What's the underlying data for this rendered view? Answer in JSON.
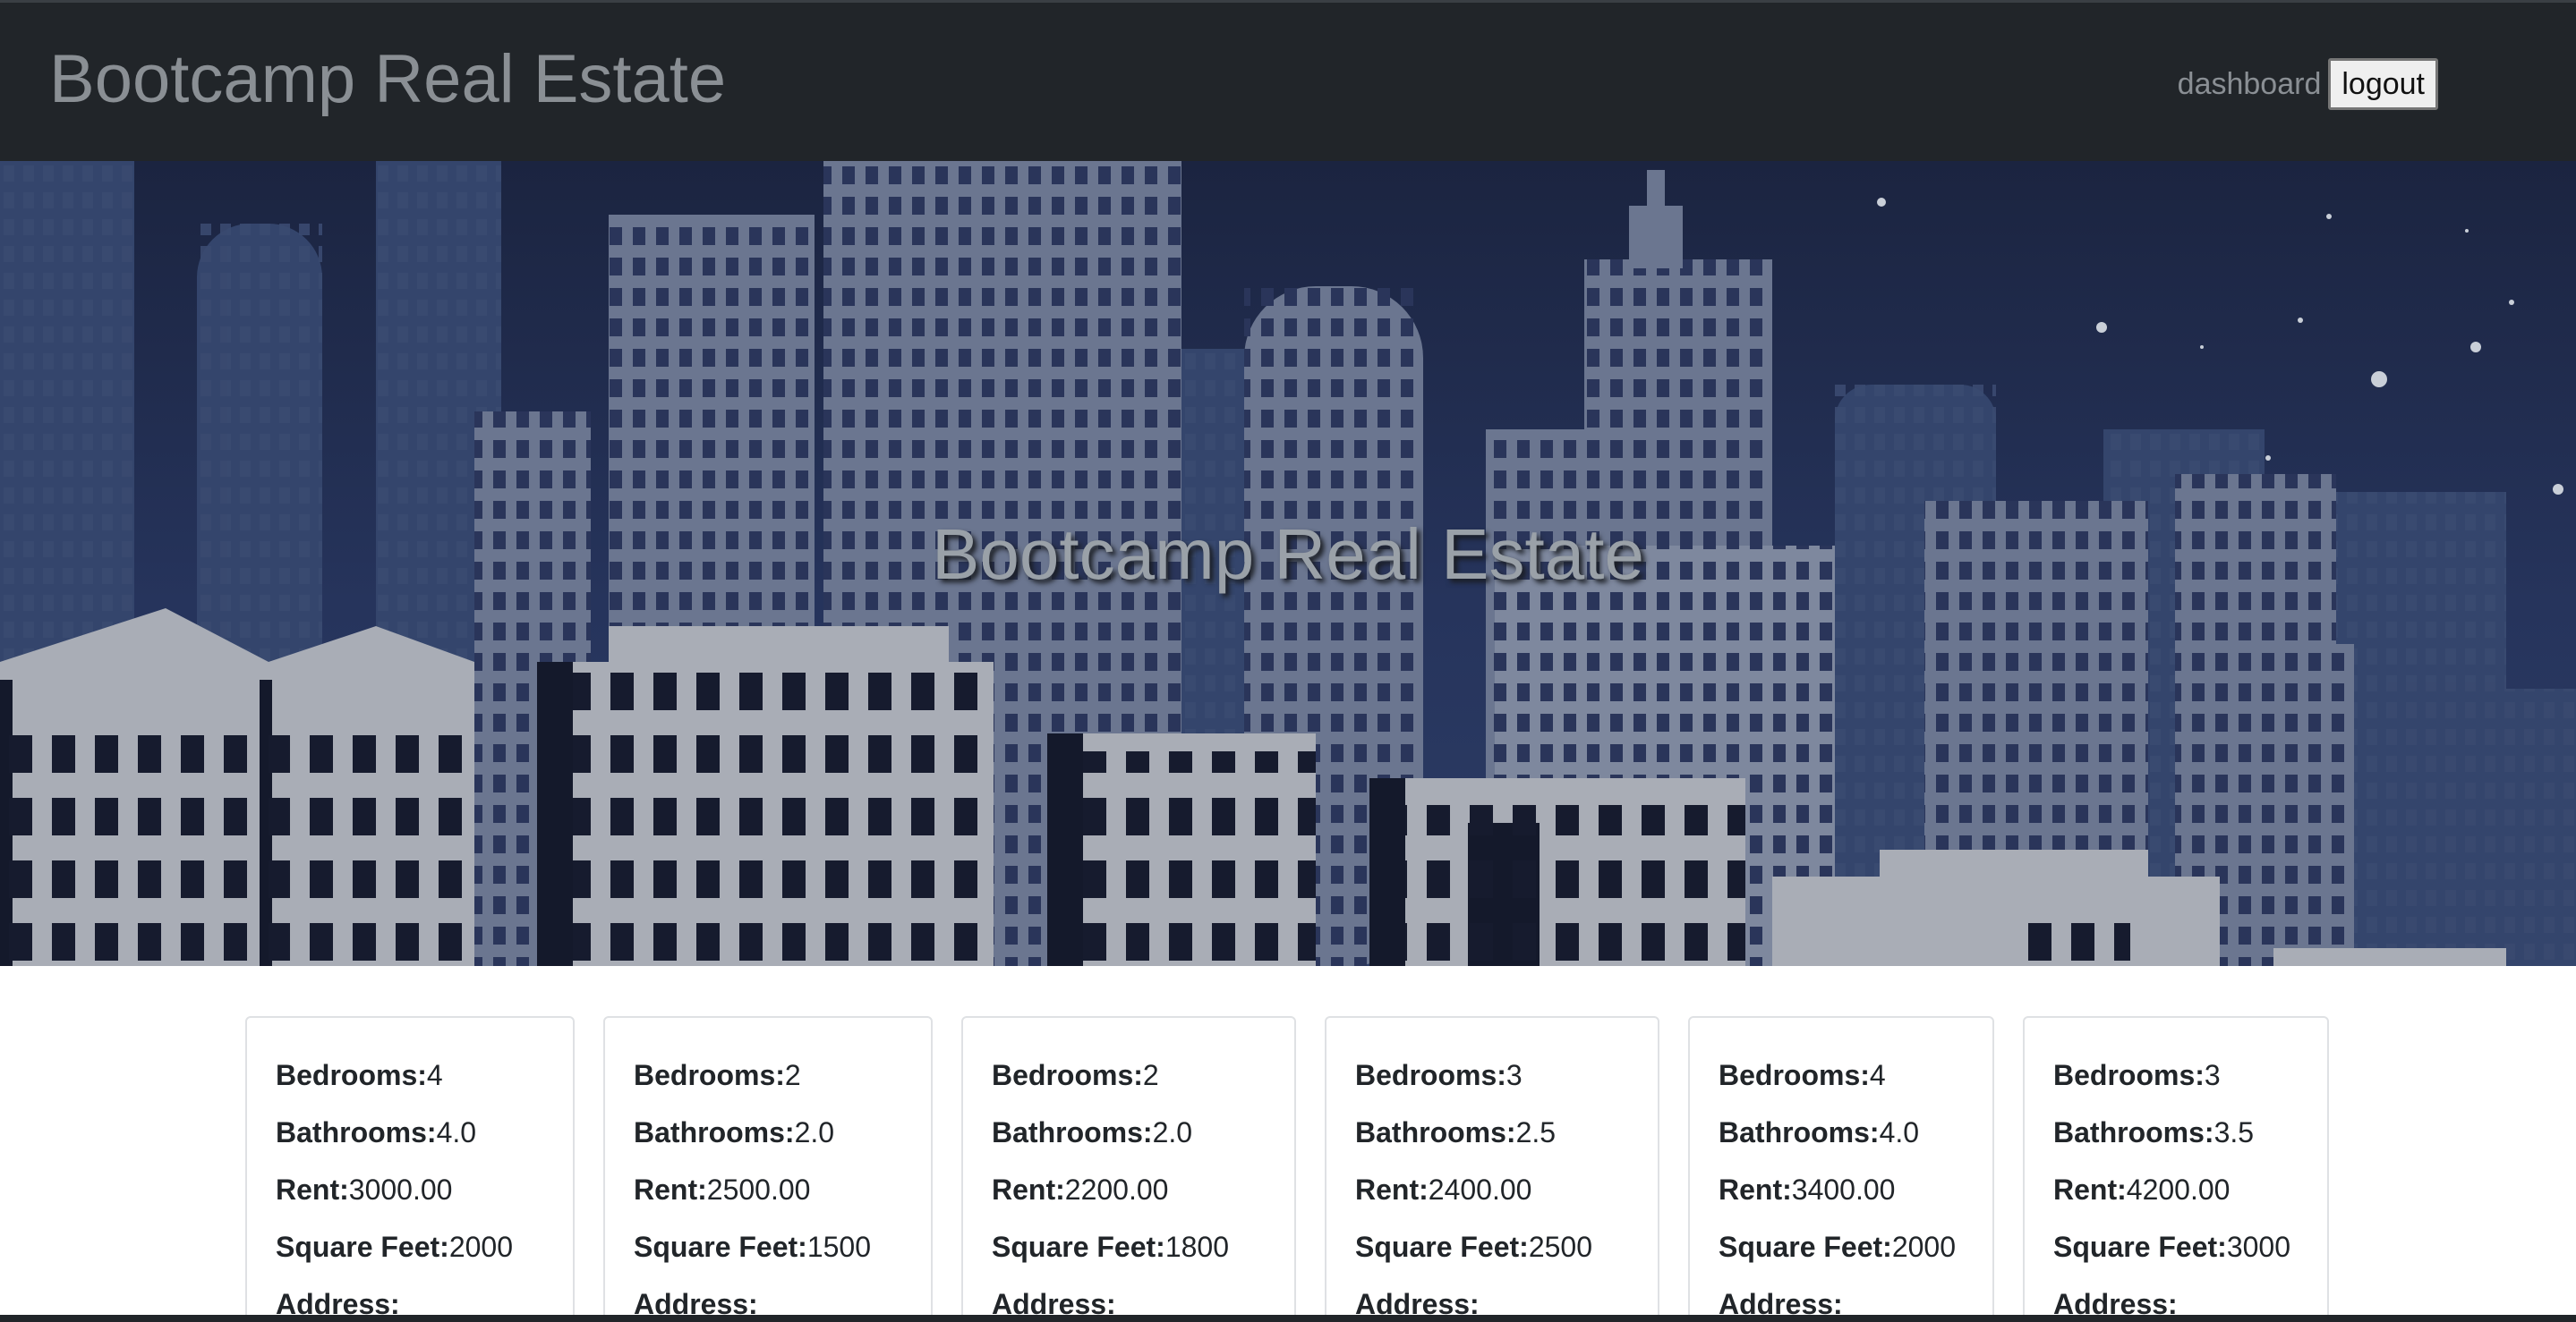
{
  "navbar": {
    "brand": "Bootcamp Real Estate",
    "dashboard_link": "dashboard",
    "logout_button": "logout"
  },
  "hero": {
    "title": "Bootcamp Real Estate"
  },
  "labels": {
    "bedrooms": "Bedrooms:",
    "bathrooms": "Bathrooms:",
    "rent": "Rent:",
    "square_feet": "Square Feet:",
    "address": "Address:"
  },
  "listings": [
    {
      "bedrooms": "4",
      "bathrooms": "4.0",
      "rent": "3000.00",
      "square_feet": "2000"
    },
    {
      "bedrooms": "2",
      "bathrooms": "2.0",
      "rent": "2500.00",
      "square_feet": "1500"
    },
    {
      "bedrooms": "2",
      "bathrooms": "2.0",
      "rent": "2200.00",
      "square_feet": "1800"
    },
    {
      "bedrooms": "3",
      "bathrooms": "2.5",
      "rent": "2400.00",
      "square_feet": "2500"
    },
    {
      "bedrooms": "4",
      "bathrooms": "4.0",
      "rent": "3400.00",
      "square_feet": "2000"
    },
    {
      "bedrooms": "3",
      "bathrooms": "3.5",
      "rent": "4200.00",
      "square_feet": "3000"
    }
  ],
  "colors": {
    "navbar_bg": "#212529",
    "nav_text": "#8a8f94",
    "hero_sky": "#26345c"
  }
}
